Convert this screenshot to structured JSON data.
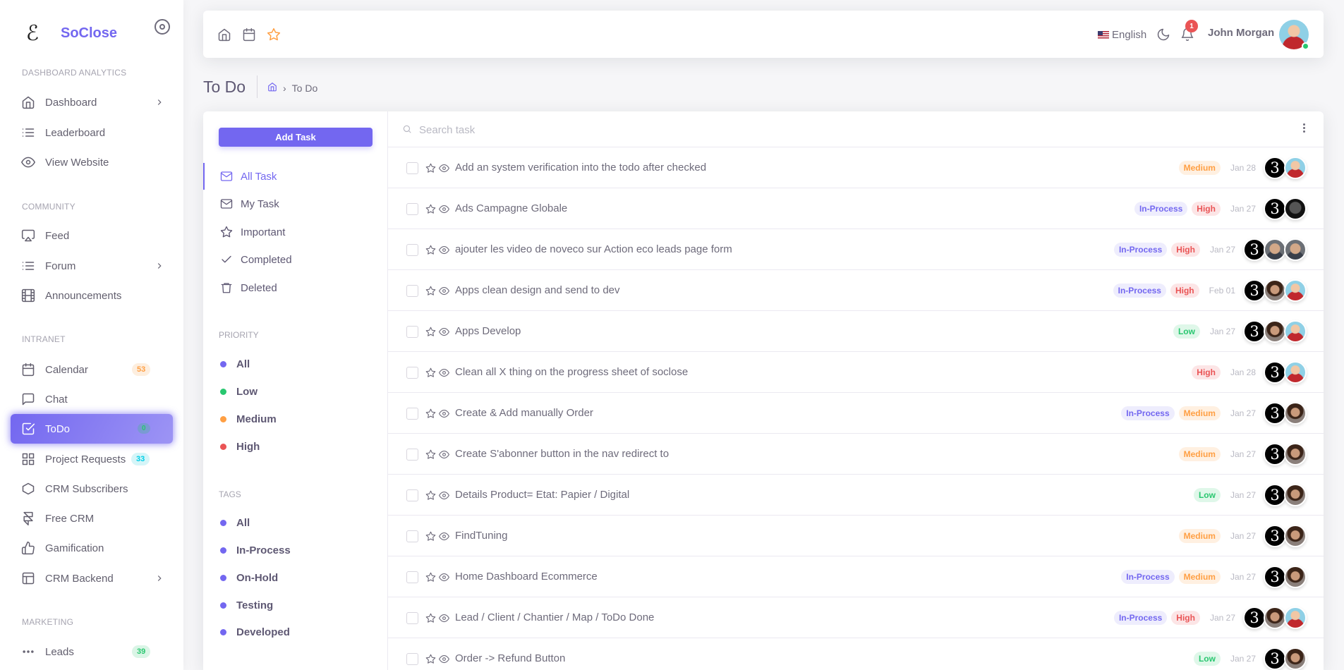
{
  "sidebar": {
    "brand": "SoClose",
    "logo_glyph": "ℰ",
    "sections": {
      "analytics": "DASHBOARD ANALYTICS",
      "community": "COMMUNITY",
      "intranet": "INTRANET",
      "marketing": "MARKETING"
    },
    "items": [
      {
        "label": "Dashboard"
      },
      {
        "label": "Leaderboard"
      },
      {
        "label": "View Website"
      },
      {
        "label": "Feed"
      },
      {
        "label": "Forum"
      },
      {
        "label": "Announcements"
      },
      {
        "label": "Calendar",
        "badge": "53"
      },
      {
        "label": "Chat"
      },
      {
        "label": "ToDo",
        "badge": "0"
      },
      {
        "label": "Project Requests",
        "badge": "33"
      },
      {
        "label": "CRM Subscribers"
      },
      {
        "label": "Free CRM"
      },
      {
        "label": "Gamification"
      },
      {
        "label": "CRM Backend"
      },
      {
        "label": "Leads",
        "badge": "39"
      }
    ]
  },
  "header": {
    "language": "English",
    "notifications": "1",
    "user_name": "John Morgan"
  },
  "page": {
    "title": "To Do",
    "breadcrumb": "To Do"
  },
  "todo": {
    "add_task": "Add Task",
    "filters": [
      "All Task",
      "My Task",
      "Important",
      "Completed",
      "Deleted"
    ],
    "priority_title": "PRIORITY",
    "priorities": [
      {
        "label": "All",
        "color": "#7367f0"
      },
      {
        "label": "Low",
        "color": "#28c76f"
      },
      {
        "label": "Medium",
        "color": "#ff9f43"
      },
      {
        "label": "High",
        "color": "#ea5455"
      }
    ],
    "tags_title": "TAGS",
    "tags": [
      {
        "label": "All",
        "color": "#7367f0"
      },
      {
        "label": "In-Process",
        "color": "#7367f0"
      },
      {
        "label": "On-Hold",
        "color": "#7367f0"
      },
      {
        "label": "Testing",
        "color": "#7367f0"
      },
      {
        "label": "Developed",
        "color": "#7367f0"
      }
    ],
    "search_placeholder": "Search task",
    "tasks": [
      {
        "title": "Add an system verification into the todo after checked",
        "tags": [
          "Medium"
        ],
        "date": "Jan 28",
        "avatars": [
          "logo",
          "john"
        ]
      },
      {
        "title": "Ads Campagne Globale",
        "tags": [
          "In-Process",
          "High"
        ],
        "date": "Jan 27",
        "avatars": [
          "logo",
          "dark"
        ]
      },
      {
        "title": "ajouter les video de noveco sur Action eco leads page form",
        "tags": [
          "In-Process",
          "High"
        ],
        "date": "Jan 27",
        "avatars": [
          "logo",
          "man",
          "man"
        ]
      },
      {
        "title": "Apps clean design and send to dev",
        "tags": [
          "In-Process",
          "High"
        ],
        "date": "Feb 01",
        "avatars": [
          "logo",
          "curly",
          "john"
        ]
      },
      {
        "title": "Apps Develop",
        "tags": [
          "Low"
        ],
        "date": "Jan 27",
        "avatars": [
          "logo",
          "curly",
          "john"
        ]
      },
      {
        "title": "Clean all X thing on the progress sheet of soclose",
        "tags": [
          "High"
        ],
        "date": "Jan 28",
        "avatars": [
          "logo",
          "john"
        ]
      },
      {
        "title": "Create & Add manually Order",
        "tags": [
          "In-Process",
          "Medium"
        ],
        "date": "Jan 27",
        "avatars": [
          "logo",
          "curly"
        ]
      },
      {
        "title": "Create S'abonner button in the nav redirect to",
        "tags": [
          "Medium"
        ],
        "date": "Jan 27",
        "avatars": [
          "logo",
          "curly"
        ]
      },
      {
        "title": "Details Product= Etat: Papier / Digital",
        "tags": [
          "Low"
        ],
        "date": "Jan 27",
        "avatars": [
          "logo",
          "curly"
        ]
      },
      {
        "title": "FindTuning",
        "tags": [
          "Medium"
        ],
        "date": "Jan 27",
        "avatars": [
          "logo",
          "curly"
        ]
      },
      {
        "title": "Home Dashboard Ecommerce",
        "tags": [
          "In-Process",
          "Medium"
        ],
        "date": "Jan 27",
        "avatars": [
          "logo",
          "curly"
        ]
      },
      {
        "title": "Lead / Client / Chantier / Map / ToDo Done",
        "tags": [
          "In-Process",
          "High"
        ],
        "date": "Jan 27",
        "avatars": [
          "logo",
          "curly",
          "john"
        ]
      },
      {
        "title": "Order -> Refund Button",
        "tags": [
          "Low"
        ],
        "date": "Jan 27",
        "avatars": [
          "logo",
          "curly"
        ]
      }
    ]
  }
}
